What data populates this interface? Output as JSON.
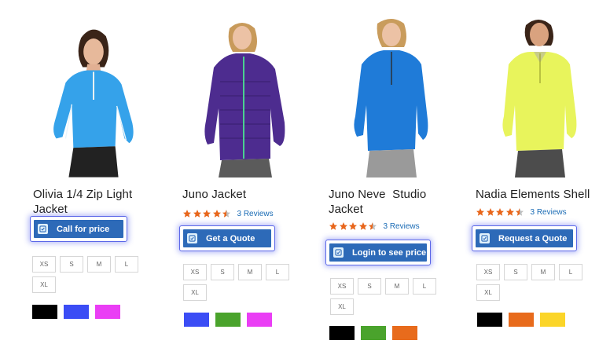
{
  "products": [
    {
      "name_lines": [
        "Olivia 1/4 Zip Light",
        "Jacket"
      ],
      "image": "woman-in-blue-quarter-zip",
      "rating": null,
      "reviews_label": "",
      "cta_label": "Call for price",
      "cta_icon": "quote-icon",
      "sizes": [
        "XS",
        "S",
        "M",
        "L",
        "XL"
      ],
      "colors": [
        "#000000",
        "#3b4df5",
        "#ea3ef5"
      ]
    },
    {
      "name_lines": [
        "Juno Jacket"
      ],
      "image": "woman-in-purple-puffer-jacket",
      "rating": 4.5,
      "reviews_label": "3  Reviews",
      "cta_label": "Get a Quote",
      "cta_icon": "quote-icon",
      "sizes": [
        "XS",
        "S",
        "M",
        "L",
        "XL"
      ],
      "colors": [
        "#3b4df5",
        "#4aa32c",
        "#ea3ef5"
      ]
    },
    {
      "name_lines": [
        "Juno Neve  Studio",
        "Jacket"
      ],
      "image": "woman-in-blue-half-zip",
      "rating": 4.5,
      "reviews_label": "3  Reviews",
      "cta_label": "Login to see price",
      "cta_icon": "quote-icon",
      "sizes": [
        "XS",
        "S",
        "M",
        "L",
        "XL"
      ],
      "colors": [
        "#000000",
        "#4aa32c",
        "#e86b1c"
      ]
    },
    {
      "name_lines": [
        "Nadia Elements Shell"
      ],
      "image": "woman-in-yellow-half-zip",
      "rating": 4.5,
      "reviews_label": "3  Reviews",
      "cta_label": "Request a Quote",
      "cta_icon": "quote-icon",
      "sizes": [
        "XS",
        "S",
        "M",
        "L",
        "XL"
      ],
      "colors": [
        "#000000",
        "#e86b1c",
        "#fbd529"
      ]
    }
  ],
  "star_color": "#e8661b",
  "cta_color": "#2d6ab8"
}
